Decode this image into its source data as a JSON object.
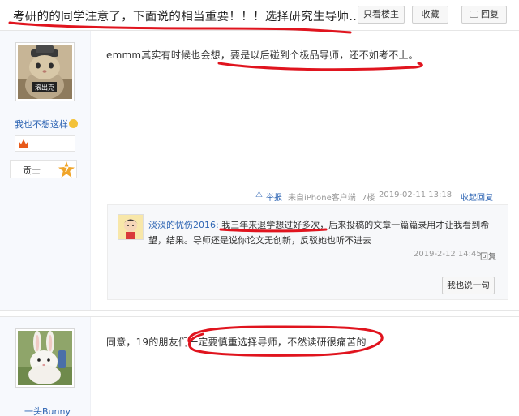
{
  "header": {
    "title": "考研的的同学注意了，下面说的相当重要！！！选择研究生导师...",
    "only_op_label": "只看楼主",
    "favorite_label": "收藏",
    "reply_label": "回复"
  },
  "posts": [
    {
      "username": "我也不想这样",
      "rank_name": "贡士",
      "rank_level": "7",
      "content": "emmm其实有时候也会想，要是以后碰到个极品导师，还不如考不上。",
      "report_label": "举报",
      "source": "来自iPhone客户端",
      "floor": "7楼",
      "time": "2019-02-11 13:18",
      "collapse_label": "收起回复",
      "reply": {
        "username": "淡淡的忧伤2016:",
        "text": "我三年来退学想过好多次，后来投稿的文章一篇篇录用才让我看到希望，结果。导师还是说你论文无创新，反驳她也听不进去",
        "time": "2019-2-12 14:45",
        "reply_label": "回复"
      },
      "say_label": "我也说一句"
    },
    {
      "username": "一头Bunny",
      "content": "同意，19的朋友们一定要慎重选择导师，不然读研很痛苦的"
    }
  ],
  "colors": {
    "link": "#2d64b3",
    "annotation": "#e0141e",
    "sidebar_bg": "#f7f9fd"
  }
}
